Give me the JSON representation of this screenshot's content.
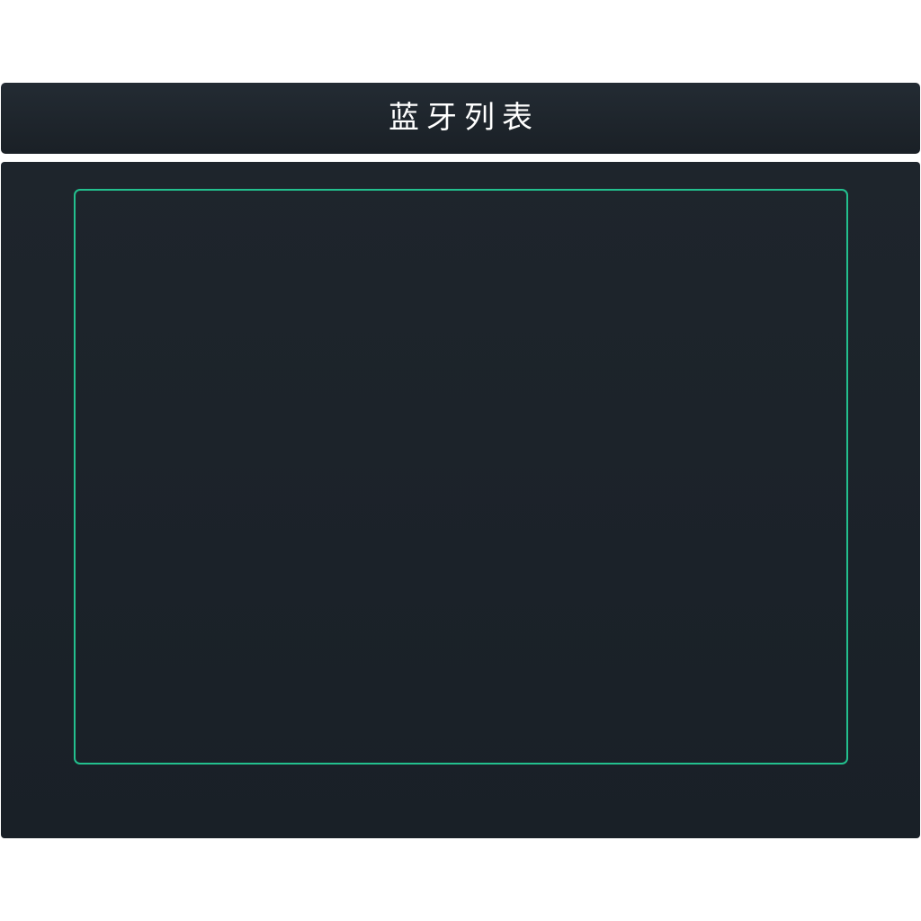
{
  "header": {
    "title": "蓝牙列表"
  },
  "device_list": {
    "items": []
  },
  "colors": {
    "background": "#ffffff",
    "panel": "#1b2228",
    "accent_border": "#23c08e",
    "title_text": "#ffffff"
  }
}
